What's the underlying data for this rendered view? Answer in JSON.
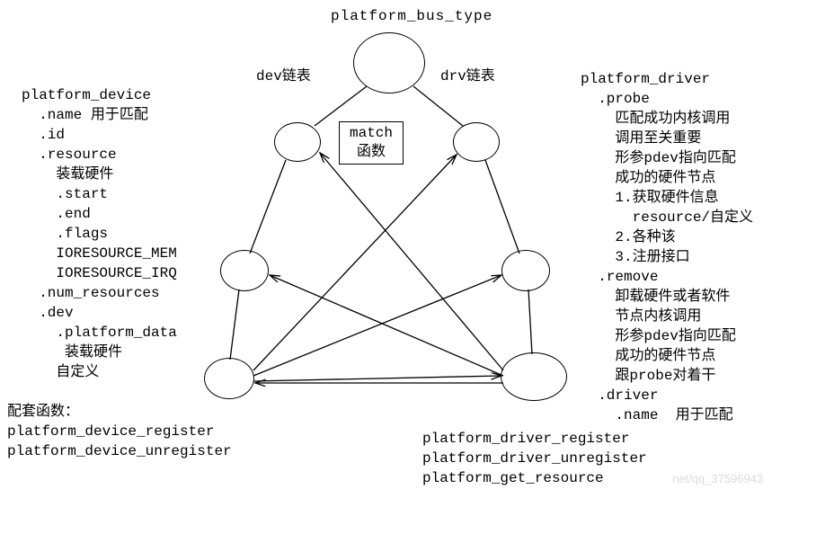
{
  "title": "platform_bus_type",
  "devlist_label": "dev链表",
  "drvlist_label": "drv链表",
  "match_line1": "match",
  "match_line2": "函数",
  "left": {
    "heading": "platform_device",
    "name_line": "  .name 用于匹配",
    "id_line": "  .id",
    "resource_line": "  .resource",
    "resource_sub": "    装载硬件",
    "start_line": "    .start",
    "end_line": "    .end",
    "flags_line": "    .flags",
    "iomem": "    IORESOURCE_MEM",
    "ioirq": "    IORESOURCE_IRQ",
    "numres": "  .num_resources",
    "dev_line": "  .dev",
    "pdata_line": "    .platform_data",
    "pdata_sub": "     装载硬件",
    "pdata_sub2": "    自定义",
    "funcs_head": "配套函数：",
    "func1": "platform_device_register",
    "func2": "platform_device_unregister"
  },
  "right": {
    "heading": "platform_driver",
    "probe": "  .probe",
    "p1": "    匹配成功内核调用",
    "p2": "    调用至关重要",
    "p3": "    形参pdev指向匹配",
    "p4": "    成功的硬件节点",
    "p5": "    1.获取硬件信息",
    "p6": "      resource/自定义",
    "p7": "    2.各种该",
    "p8": "    3.注册接口",
    "remove": "  .remove",
    "r1": "    卸载硬件或者软件",
    "r2": "    节点内核调用",
    "r3": "    形参pdev指向匹配",
    "r4": "    成功的硬件节点",
    "r5": "    跟probe对着干",
    "driver": "  .driver",
    "driver_name": "    .name  用于匹配",
    "func1": "platform_driver_register",
    "func2": "platform_driver_unregister",
    "func3": "platform_get_resource"
  },
  "watermark": "net/qq_37596943"
}
